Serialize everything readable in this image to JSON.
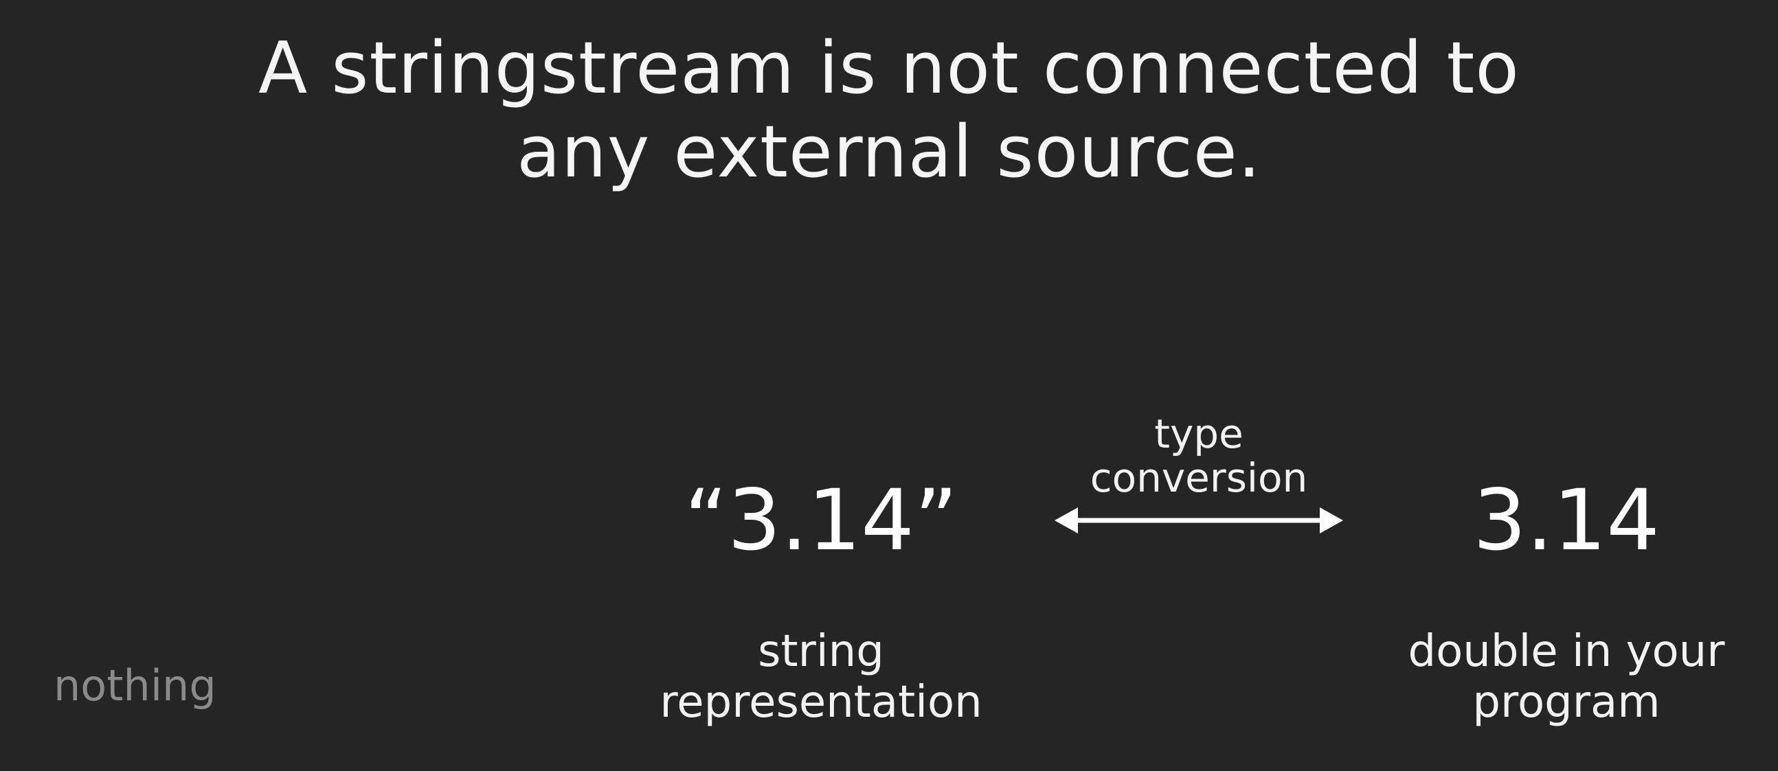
{
  "title": {
    "line1": "A stringstream is not connected to",
    "line2": "any external source."
  },
  "left_value": {
    "text": "“3.14”",
    "caption_line1": "string",
    "caption_line2": "representation"
  },
  "arrow": {
    "label_line1": "type",
    "label_line2": "conversion",
    "icon": "double-headed-arrow-icon"
  },
  "right_value": {
    "text": "3.14",
    "caption_line1": "double in your",
    "caption_line2": "program"
  },
  "side_label": "nothing",
  "colors": {
    "background": "#252525",
    "text": "#ffffff",
    "muted_text": "#8a8a8a"
  }
}
